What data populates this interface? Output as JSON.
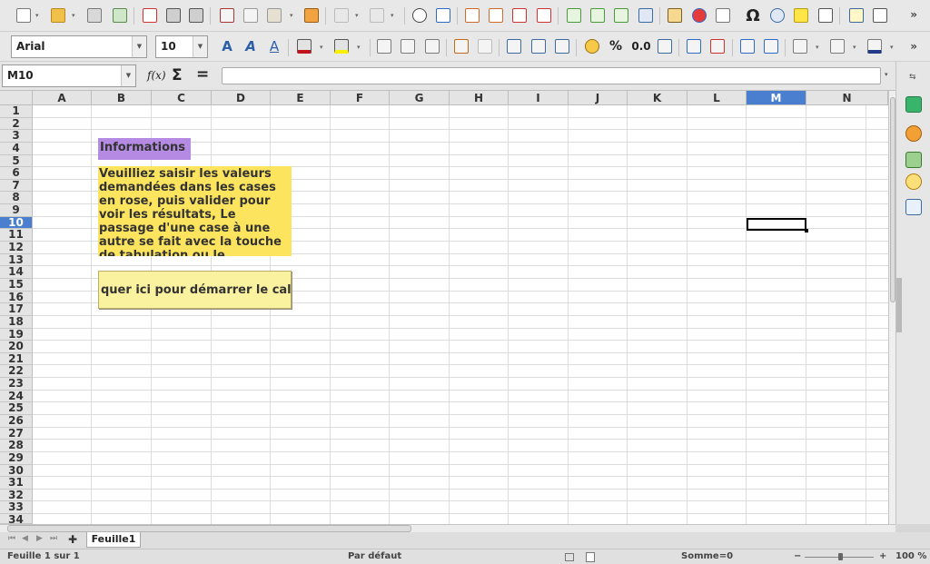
{
  "toolbar": {
    "more": "»",
    "font_name": "Arial",
    "font_size": "10",
    "percent": "%",
    "number_format": "0.0",
    "special_char": "Ω"
  },
  "formula_bar": {
    "name_box": "M10",
    "func_wizard": "f(x)",
    "sum": "Σ",
    "equals": "=",
    "input_value": ""
  },
  "grid": {
    "columns": [
      "A",
      "B",
      "C",
      "D",
      "E",
      "F",
      "G",
      "H",
      "I",
      "J",
      "K",
      "L",
      "M",
      "N"
    ],
    "rows": [
      "1",
      "2",
      "3",
      "4",
      "5",
      "6",
      "7",
      "8",
      "9",
      "10",
      "11",
      "12",
      "13",
      "14",
      "15",
      "16",
      "17",
      "18",
      "19",
      "20",
      "21",
      "22",
      "23",
      "24",
      "25",
      "26",
      "27",
      "28",
      "29",
      "30",
      "31",
      "32",
      "33",
      "34"
    ],
    "selected_column": "M",
    "selected_row": "10"
  },
  "cells": {
    "info_label": "Informations",
    "info_text": "Veuilliez saisir les valeurs demandées dans les cases en rose, puis valider pour voir les résultats, Le passage d'une case à une autre se fait avec la touche de tabulation ou le",
    "start_button": "quer ici pour démarrer le calcul"
  },
  "tabs": {
    "add": "✚",
    "sheet": "Feuille1"
  },
  "status": {
    "sheet_info": "Feuille 1 sur 1",
    "page_style": "Par défaut",
    "sum": "Somme=0",
    "zoom_minus": "−",
    "zoom_plus": "+",
    "zoom": "100 %"
  },
  "colors": {
    "accent": "#4a7fd0",
    "info_label_bg": "#b48ae3",
    "info_text_bg": "#fce45e",
    "button_bg": "#fbf2a0"
  }
}
